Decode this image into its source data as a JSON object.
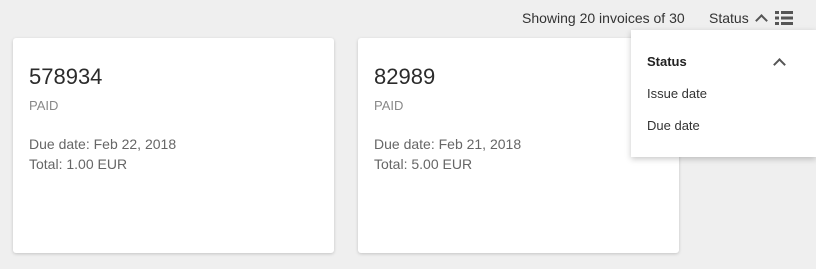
{
  "header": {
    "count_text": "Showing 20 invoices of 30",
    "sort_label": "Status",
    "sort_icon": "chevron-up-icon",
    "view_icon": "list-view-icon"
  },
  "invoices": [
    {
      "number": "578934",
      "status": "PAID",
      "due": "Due date: Feb 22, 2018",
      "total": "Total: 1.00 EUR"
    },
    {
      "number": "82989",
      "status": "PAID",
      "due": "Due date: Feb 21, 2018",
      "total": "Total: 5.00 EUR"
    }
  ],
  "sort_menu": {
    "items": [
      {
        "label": "Status",
        "selected": true
      },
      {
        "label": "Issue date",
        "selected": false
      },
      {
        "label": "Due date",
        "selected": false
      }
    ]
  },
  "colors": {
    "background": "#efefef",
    "card": "#ffffff",
    "text": "#333333",
    "muted": "#888888"
  }
}
